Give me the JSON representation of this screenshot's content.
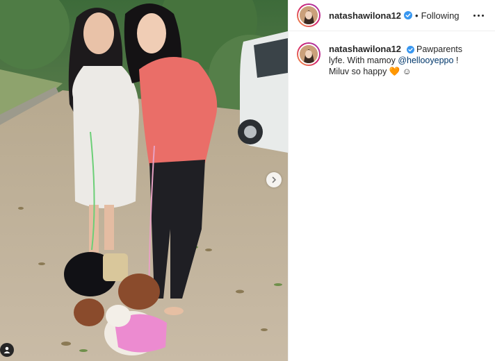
{
  "post": {
    "username": "natashawilona12",
    "dot": "•",
    "follow_status": "Following",
    "caption": {
      "username": "natashawilona12",
      "text_part1": "Pawparents lyfe. With mamoy ",
      "mention": "@hellooyeppo",
      "text_part2": " ! Miluv so happy ",
      "emoji_heart": "🧡",
      "emoji_smile": "☺"
    }
  },
  "icons": {
    "verified": "verified-badge-icon",
    "more": "more-options-icon",
    "next": "chevron-right-icon",
    "tag": "user-tag-icon"
  },
  "colors": {
    "verified_blue": "#3897f0",
    "mention": "#00376b",
    "text": "#262626"
  }
}
